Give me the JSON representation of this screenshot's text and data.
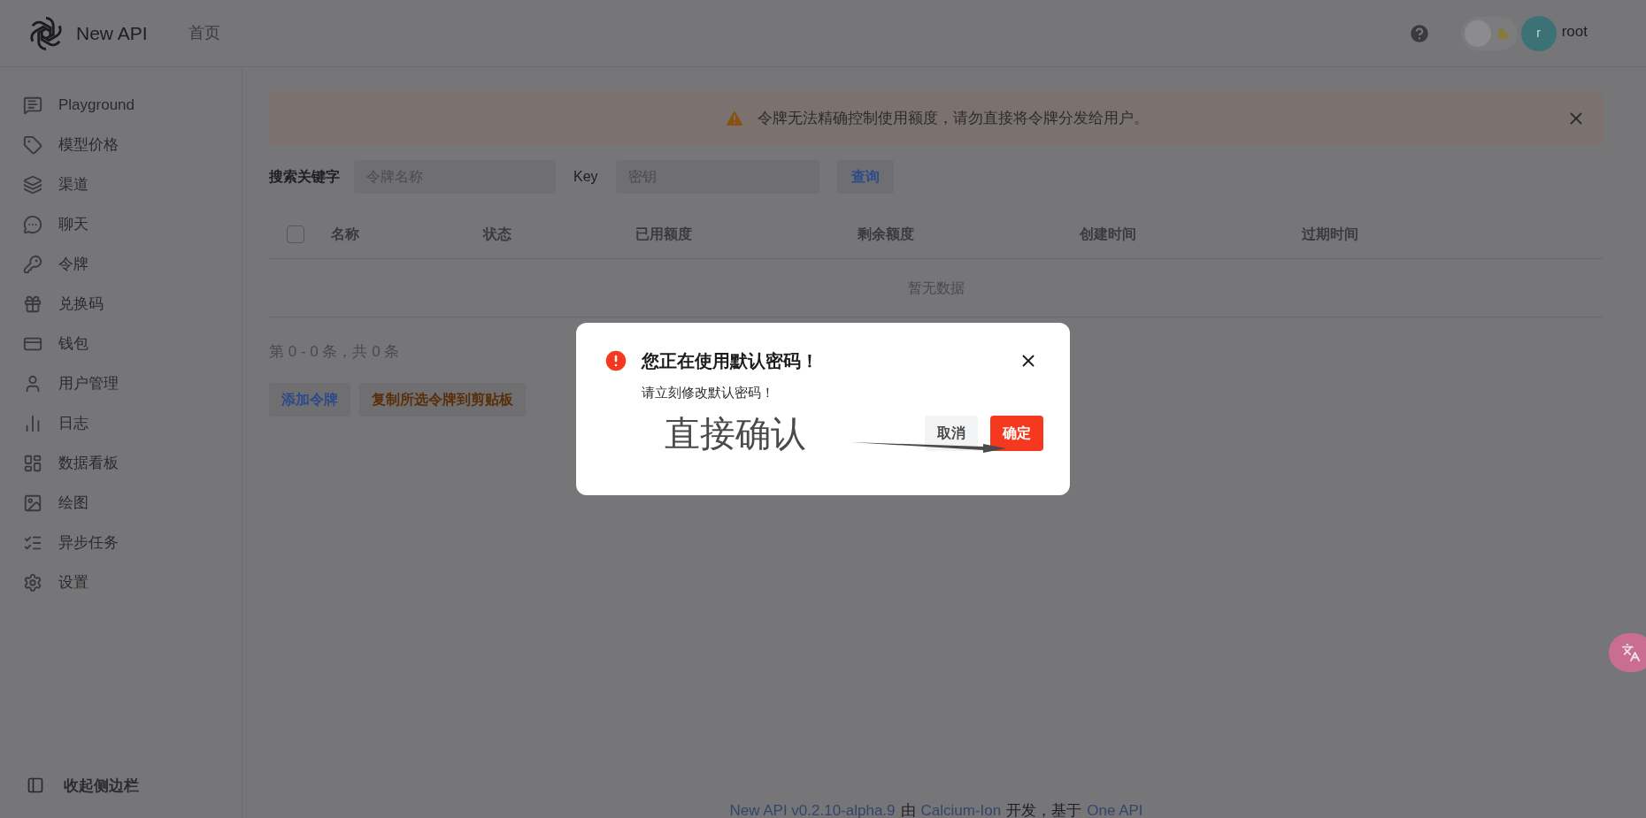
{
  "header": {
    "brand": "New API",
    "nav": [
      {
        "label": "首页"
      }
    ],
    "dark_mode": false,
    "user": {
      "avatar_letter": "r",
      "name": "root"
    }
  },
  "sidebar": {
    "items": [
      {
        "label": "Playground"
      },
      {
        "label": "模型价格"
      },
      {
        "label": "渠道"
      },
      {
        "label": "聊天"
      },
      {
        "label": "令牌"
      },
      {
        "label": "兑换码"
      },
      {
        "label": "钱包"
      },
      {
        "label": "用户管理"
      },
      {
        "label": "日志"
      },
      {
        "label": "数据看板"
      },
      {
        "label": "绘图"
      },
      {
        "label": "异步任务"
      },
      {
        "label": "设置"
      }
    ],
    "collapse": "收起侧边栏"
  },
  "banner": {
    "text": "令牌无法精确控制使用额度，请勿直接将令牌分发给用户。"
  },
  "search": {
    "label": "搜索关键字",
    "name_placeholder": "令牌名称",
    "key_label": "Key",
    "key_placeholder": "密钥",
    "button": "查询"
  },
  "table": {
    "select_all_checked": false,
    "columns": [
      "名称",
      "状态",
      "已用额度",
      "剩余额度",
      "创建时间",
      "过期时间"
    ],
    "empty": "暂无数据"
  },
  "pagination": "第 0 - 0 条，共 0 条",
  "actions": [
    {
      "label": "添加令牌",
      "kind": "primary"
    },
    {
      "label": "复制所选令牌到剪贴板",
      "kind": "warning"
    }
  ],
  "dialog": {
    "title": "您正在使用默认密码！",
    "message": "请立刻修改默认密码！",
    "buttons": [
      {
        "label": "取消",
        "kind": "secondary"
      },
      {
        "label": "确定",
        "kind": "danger"
      }
    ]
  },
  "annotation": {
    "text": "直接确认"
  },
  "footer": [
    {
      "text": "New API v0.2.10-alpha.9",
      "link": true
    },
    {
      "text": "由",
      "link": false
    },
    {
      "text": "Calcium-Ion",
      "link": true
    },
    {
      "text": "开发，基于",
      "link": false
    },
    {
      "text": "One API",
      "link": true
    }
  ]
}
